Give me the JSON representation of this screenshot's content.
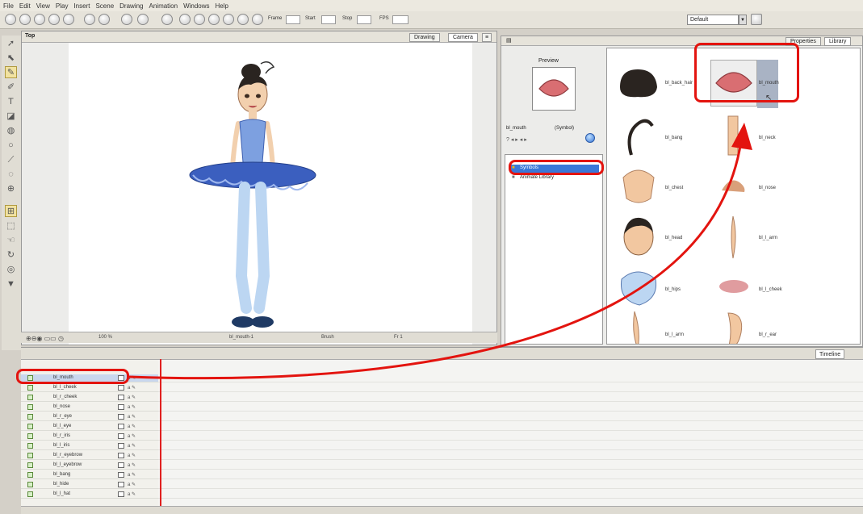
{
  "menu": [
    "File",
    "Edit",
    "View",
    "Play",
    "Insert",
    "Scene",
    "Drawing",
    "Animation",
    "Windows",
    "Help"
  ],
  "toolbar": {
    "frame_label": "Frame",
    "start_label": "Start",
    "stop_label": "Stop",
    "fps_label": "FPS",
    "workspace": "Default"
  },
  "top_view": {
    "title": "Top",
    "tabs": [
      "Drawing",
      "Camera"
    ],
    "active_tab": "Camera"
  },
  "status_bar": {
    "zoom": "100 %",
    "drawing_name": "bl_mouth-1",
    "tool": "Brush",
    "frame": "Fr 1"
  },
  "library": {
    "tabs": [
      "Properties",
      "Library"
    ],
    "active_tab": "Library",
    "preview_label": "Preview",
    "selected_name": "bl_mouth",
    "selected_type": "(Symbol)",
    "tree": [
      {
        "label": "Symbols",
        "selected": true
      },
      {
        "label": "Animate Library",
        "selected": false
      }
    ],
    "items": [
      {
        "label": "bl_back_hair"
      },
      {
        "label": "bl_mouth"
      },
      {
        "label": "bl_bang"
      },
      {
        "label": "bl_neck"
      },
      {
        "label": "bl_chest"
      },
      {
        "label": "bl_nose"
      },
      {
        "label": "bl_head"
      },
      {
        "label": "bl_l_arm"
      },
      {
        "label": "bl_hips"
      },
      {
        "label": "bl_l_cheek"
      },
      {
        "label": "bl_l_arm"
      },
      {
        "label": "bl_r_ear"
      }
    ]
  },
  "timeline": {
    "tab": "Timeline",
    "layers": [
      {
        "name": "bl_mouth",
        "selected": true
      },
      {
        "name": "bl_l_cheek"
      },
      {
        "name": "bl_r_cheek"
      },
      {
        "name": "bl_nose"
      },
      {
        "name": "bl_r_eye"
      },
      {
        "name": "bl_l_eye"
      },
      {
        "name": "bl_r_iris"
      },
      {
        "name": "bl_l_iris"
      },
      {
        "name": "bl_r_eyebrow"
      },
      {
        "name": "bl_l_eyebrow"
      },
      {
        "name": "bl_bang"
      },
      {
        "name": "bl_hide"
      },
      {
        "name": "bl_l_hat"
      }
    ]
  },
  "colors": {
    "callout": "#e3140f",
    "accent_selected": "#3a78d8",
    "tutu": "#3b5fbf"
  }
}
